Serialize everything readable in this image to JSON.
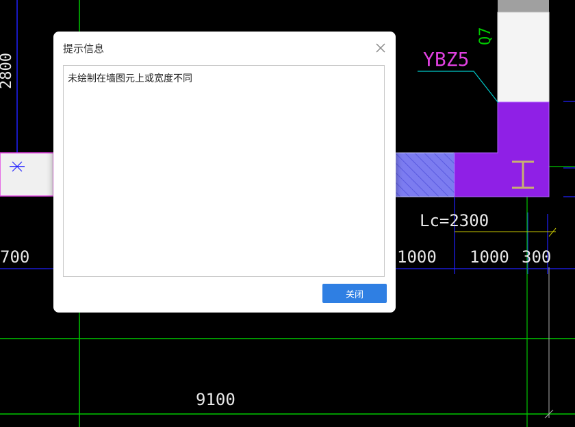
{
  "dialog": {
    "title": "提示信息",
    "message": "未绘制在墙图元上或宽度不同",
    "close_button_label": "关闭",
    "close_icon": "close-icon"
  },
  "cad": {
    "labels": {
      "column_tag": "YBZ5",
      "vertical_tag": "Q7",
      "lc_label": "Lc=2300",
      "dim_2800": "2800",
      "dim_700": "700",
      "dim_1000_left": "1000",
      "dim_1000_right": "1000",
      "dim_300": "300",
      "dim_9100": "9100"
    },
    "colors": {
      "background": "#000000",
      "grid_green": "#00c800",
      "dim_blue": "#2020ff",
      "column_purple": "#8f20e6",
      "tag_magenta": "#e040e0",
      "leader_cyan": "#00c8c8",
      "text_white": "#e8e8e8"
    }
  }
}
